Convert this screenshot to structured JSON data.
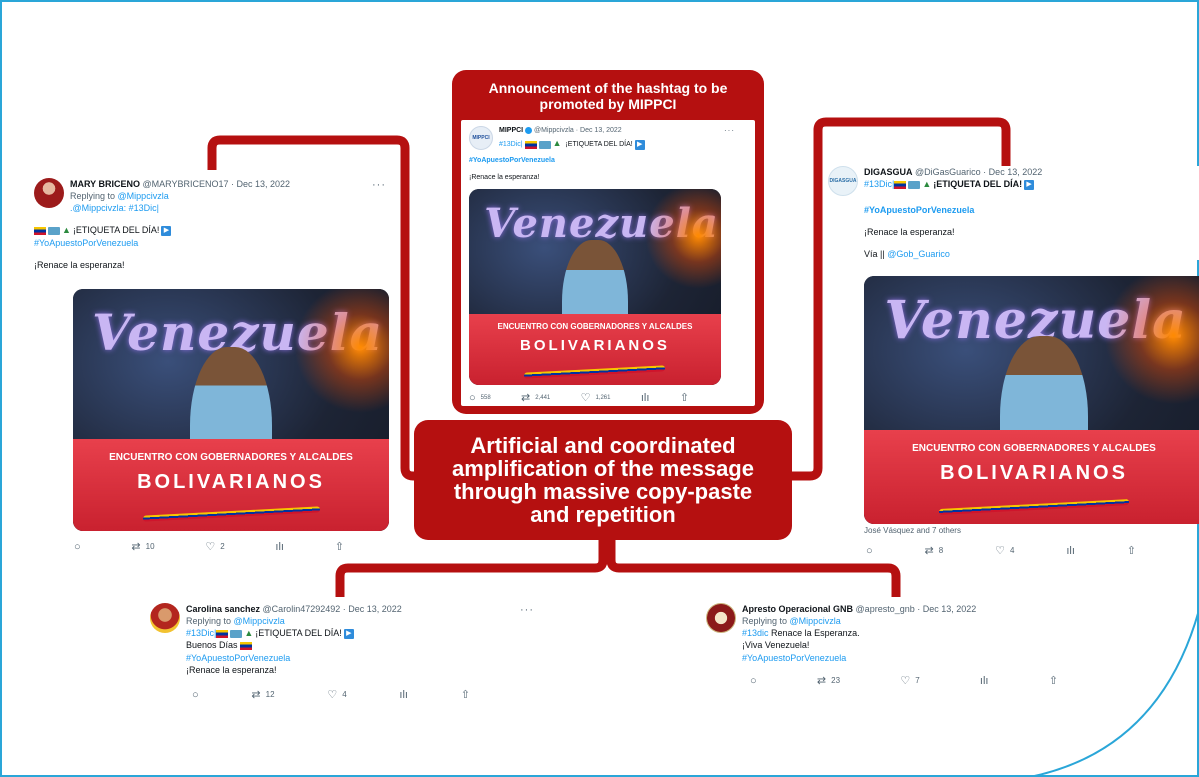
{
  "banner_top": {
    "title": "Announcement of the hashtag to be promoted by MIPPCI"
  },
  "banner_mid": {
    "text": "Artificial and coordinated amplification of the message through massive copy-paste and repetition"
  },
  "photo": {
    "sign_top": "Venezuela",
    "desk_line1": "ENCUENTRO CON GOBERNADORES Y ALCALDES",
    "desk_line2": "BOLIVARIANOS"
  },
  "tweets": {
    "mippci": {
      "name": "MIPPCI",
      "handle": "@Mippcivzla · Dec 13, 2022",
      "line1_tag": "#13Dic|",
      "line1_text": "¡ETIQUETA DEL DÍA!",
      "hashtag": "#YoApuestoPorVenezuela",
      "body": "¡Renace la esperanza!",
      "replies": "558",
      "retweets": "2,441",
      "likes": "1,261",
      "more": "···"
    },
    "mary": {
      "name": "MARY BRICENO",
      "handle": "@MARYBRICENO17 · Dec 13, 2022",
      "replying": "Replying to",
      "reply_to": "@Mippcivzla",
      "mention_line": ".@Mippcivzla: #13Dic|",
      "etiqueta": "¡ETIQUETA DEL DÍA!",
      "hashtag": "#YoApuestoPorVenezuela",
      "body": "¡Renace la esperanza!",
      "retweets": "10",
      "likes": "2",
      "more": "···"
    },
    "digasgua": {
      "name": "DIGASGUA",
      "handle": "@DiGasGuarico · Dec 13, 2022",
      "line1_tag": "#13Dic|",
      "line1_text": "¡ETIQUETA DEL DÍA!",
      "hashtag": "#YoApuestoPorVenezuela",
      "body": "¡Renace la esperanza!",
      "via": "Vía ||",
      "via_handle": "@Gob_Guarico",
      "tagged": "José Vásquez and 7 others",
      "retweets": "8",
      "likes": "4"
    },
    "carolina": {
      "name": "Carolina sanchez",
      "handle": "@Carolin47292492 · Dec 13, 2022",
      "replying": "Replying to",
      "reply_to": "@Mippcivzla",
      "line1_tag": "#13Dic|",
      "line1_text": "¡ETIQUETA DEL DÍA!",
      "greeting": "Buenos Días",
      "hashtag": "#YoApuestoPorVenezuela",
      "body": "¡Renace la esperanza!",
      "retweets": "12",
      "likes": "4",
      "more": "···"
    },
    "apresto": {
      "name": "Apresto Operacional GNB",
      "handle": "@apresto_gnb · Dec 13, 2022",
      "replying": "Replying to",
      "reply_to": "@Mippcivzla",
      "line1_tag": "#13dic",
      "line1_text": "Renace la Esperanza.",
      "line2": "¡Viva Venezuela!",
      "hashtag": "#YoApuestoPorVenezuela",
      "retweets": "23",
      "likes": "7"
    }
  },
  "colors": {
    "banner_red": "#b51010",
    "link_blue": "#1d9bf0",
    "frame_blue": "#2aa6d8"
  }
}
